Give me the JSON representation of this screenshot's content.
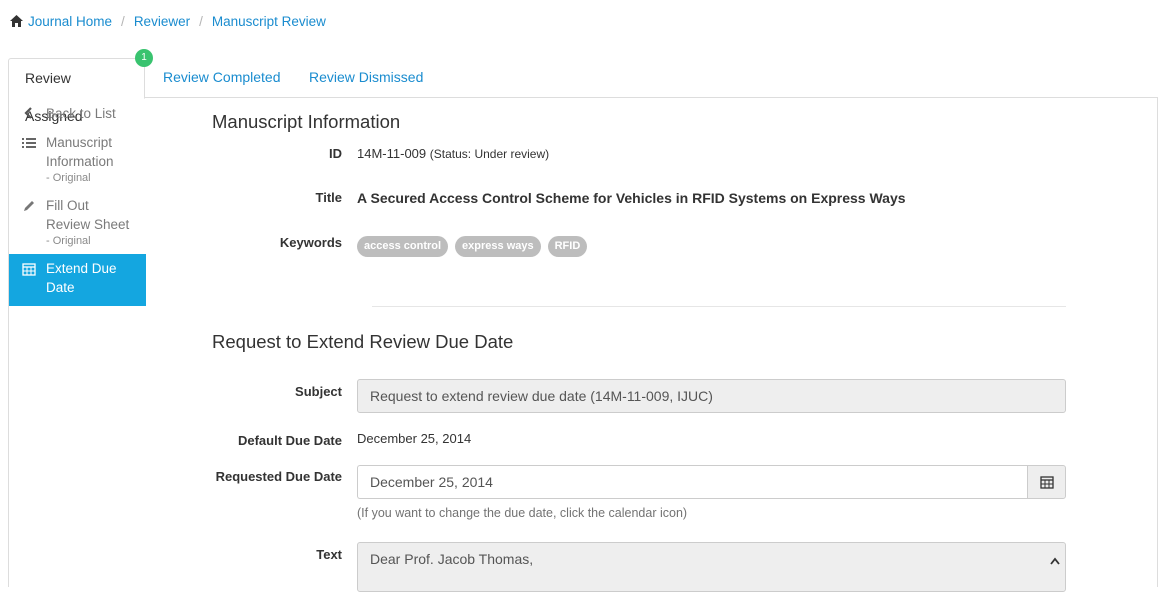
{
  "breadcrumb": {
    "items": [
      "Journal Home",
      "Reviewer",
      "Manuscript Review"
    ],
    "separator": "/"
  },
  "tabs": [
    {
      "label": "Review Assigned",
      "active": true,
      "badge": "1"
    },
    {
      "label": "Review Completed",
      "active": false
    },
    {
      "label": "Review Dismissed",
      "active": false
    }
  ],
  "sidebar": {
    "back": "Back to List",
    "items": [
      {
        "label": "Manuscript Information",
        "line1": "Manuscript",
        "line2": "Information",
        "sub": "- Original",
        "icon": "list-icon"
      },
      {
        "label": "Fill Out Review Sheet",
        "line1": "Fill Out",
        "line2": "Review Sheet",
        "sub": "- Original",
        "icon": "pencil-icon"
      },
      {
        "label": "Extend Due Date",
        "line1": "Extend Due",
        "line2": "Date",
        "icon": "calendar-icon",
        "active": true
      }
    ]
  },
  "manuscript": {
    "heading": "Manuscript Information",
    "id_label": "ID",
    "id_value": "14M-11-009",
    "status": "(Status: Under review)",
    "title_label": "Title",
    "title_value": "A Secured Access Control Scheme for Vehicles in RFID Systems on Express Ways",
    "keywords_label": "Keywords",
    "keywords": [
      "access control",
      "express ways",
      "RFID"
    ]
  },
  "request": {
    "heading": "Request to Extend Review Due Date",
    "subject_label": "Subject",
    "subject_value": "Request to extend review due date (14M-11-009, IJUC)",
    "default_label": "Default Due Date",
    "default_value": "December 25, 2014",
    "requested_label": "Requested Due Date",
    "requested_value": "December 25, 2014",
    "help": "(If you want to change the due date, click the calendar icon)",
    "text_label": "Text",
    "text_value": "Dear Prof. Jacob Thomas,"
  },
  "colors": {
    "link": "#1a8ccf",
    "active_sidebar": "#14a6e0",
    "badge": "#39c36f",
    "keyword_tag": "#bdbdbd"
  }
}
